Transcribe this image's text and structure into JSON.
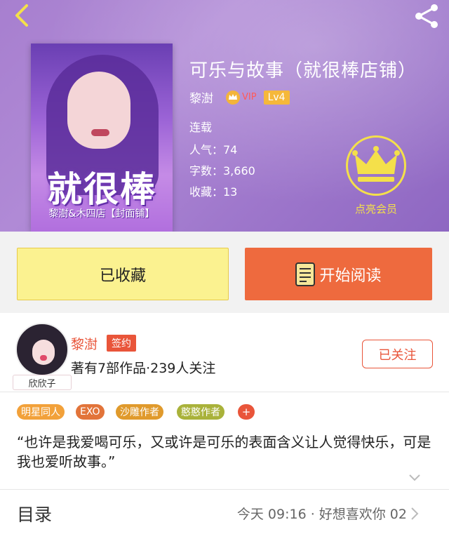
{
  "book": {
    "title": "可乐与故事（就很棒店铺）",
    "author": "黎澍",
    "vip_label": "VIP",
    "level": "Lv4",
    "status": "连载",
    "popularity": "人气：74",
    "word_count": "字数：3,660",
    "favorites": "收藏：13",
    "cover_title": "就很棒",
    "cover_subtitle": "黎澍&木四店【封面铺】"
  },
  "member": {
    "label": "点亮会员"
  },
  "actions": {
    "collected_label": "已收藏",
    "read_label": "开始阅读"
  },
  "author_card": {
    "name": "黎澍",
    "sign_badge": "签约",
    "stats": "著有7部作品·239人关注",
    "follow_label": "已关注",
    "avatar_tag": "欣欣子"
  },
  "tags": [
    "明星同人",
    "EXO",
    "沙雕作者",
    "憨憨作者"
  ],
  "tag_add": "+",
  "intro": "“也许是我爱喝可乐，又或许是可乐的表面含义让人觉得快乐，可是我也爱听故事。”",
  "toc": {
    "label": "目录",
    "latest": "今天 09:16 · 好想喜欢你 02"
  },
  "colors": {
    "accent": "#e9553a",
    "gold": "#f4e04a",
    "collected_bg": "#fbf290",
    "read_bg": "#ee6a3e"
  },
  "icons": [
    "back-arrow-icon",
    "share-icon",
    "crown-icon",
    "vip-crown-icon",
    "book-icon",
    "chevron-down-icon",
    "chevron-right-icon"
  ]
}
